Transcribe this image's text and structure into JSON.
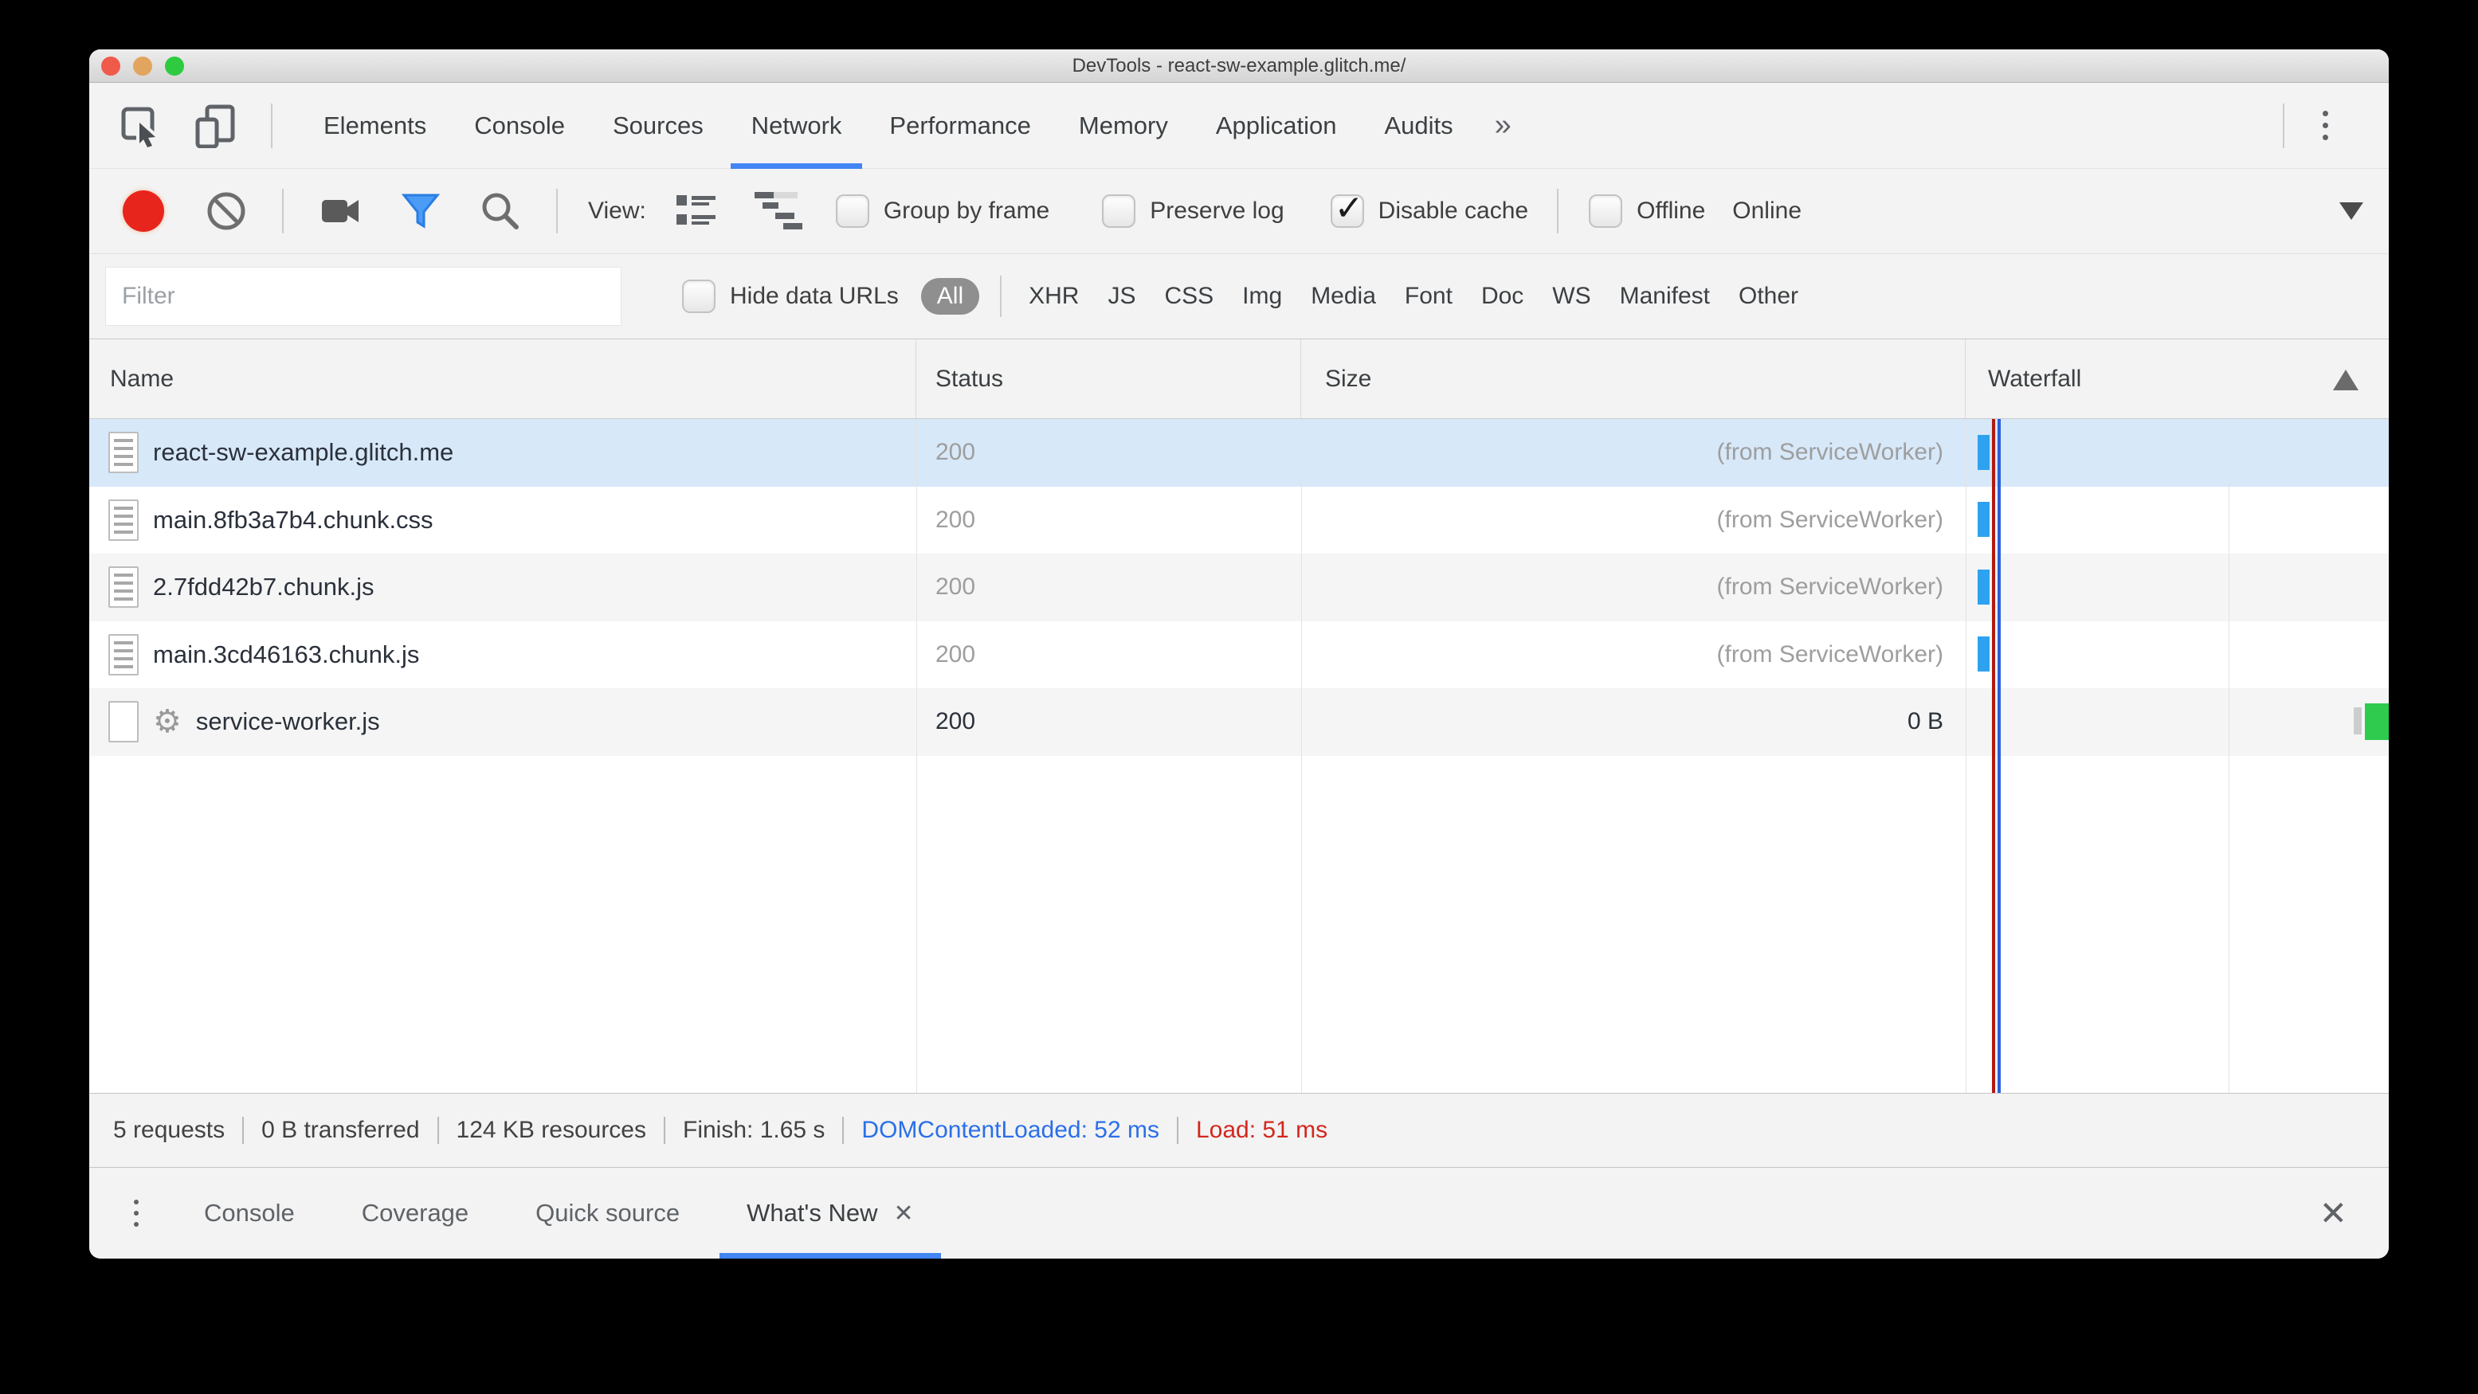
{
  "window": {
    "title": "DevTools - react-sw-example.glitch.me/"
  },
  "tabs": {
    "items": [
      "Elements",
      "Console",
      "Sources",
      "Network",
      "Performance",
      "Memory",
      "Application",
      "Audits"
    ],
    "active": "Network",
    "overflow": "»"
  },
  "net_toolbar": {
    "view_label": "View:",
    "group_by_frame": "Group by frame",
    "preserve_log": "Preserve log",
    "disable_cache": "Disable cache",
    "offline": "Offline",
    "online": "Online",
    "disable_cache_checked": true
  },
  "filter_bar": {
    "placeholder": "Filter",
    "hide_data_urls": "Hide data URLs",
    "types": [
      "All",
      "XHR",
      "JS",
      "CSS",
      "Img",
      "Media",
      "Font",
      "Doc",
      "WS",
      "Manifest",
      "Other"
    ],
    "active_type": "All"
  },
  "table": {
    "columns": [
      "Name",
      "Status",
      "Size",
      "Waterfall"
    ],
    "sort": "ascending",
    "rows": [
      {
        "name": "react-sw-example.glitch.me",
        "status": "200",
        "size": "(from ServiceWorker)",
        "selected": true
      },
      {
        "name": "main.8fb3a7b4.chunk.css",
        "status": "200",
        "size": "(from ServiceWorker)"
      },
      {
        "name": "2.7fdd42b7.chunk.js",
        "status": "200",
        "size": "(from ServiceWorker)"
      },
      {
        "name": "main.3cd46163.chunk.js",
        "status": "200",
        "size": "(from ServiceWorker)"
      },
      {
        "name": "service-worker.js",
        "status": "200",
        "size": "0 B",
        "service_worker_gear": true
      }
    ]
  },
  "summary": {
    "requests": "5 requests",
    "transferred": "0 B transferred",
    "resources": "124 KB resources",
    "finish": "Finish: 1.65 s",
    "dcl": "DOMContentLoaded: 52 ms",
    "load": "Load: 51 ms"
  },
  "drawer": {
    "tabs": [
      "Console",
      "Coverage",
      "Quick source",
      "What's New"
    ],
    "active": "What's New"
  },
  "icons": {
    "check": "✓",
    "gear": "⚙",
    "close": "✕",
    "tab_close": "✕"
  },
  "colors": {
    "accent_blue": "#4285f4",
    "selection_blue": "#d7e8f9",
    "waterfall_bar_blue": "#2fa2ef",
    "waterfall_bar_green": "#2ecb4e",
    "load_line_red": "#b11a10",
    "dcl_line_blue": "#2a5fd8",
    "dcl_text_blue": "#2a6fe8",
    "load_text_red": "#d2281e",
    "record_red": "#e8251c"
  }
}
